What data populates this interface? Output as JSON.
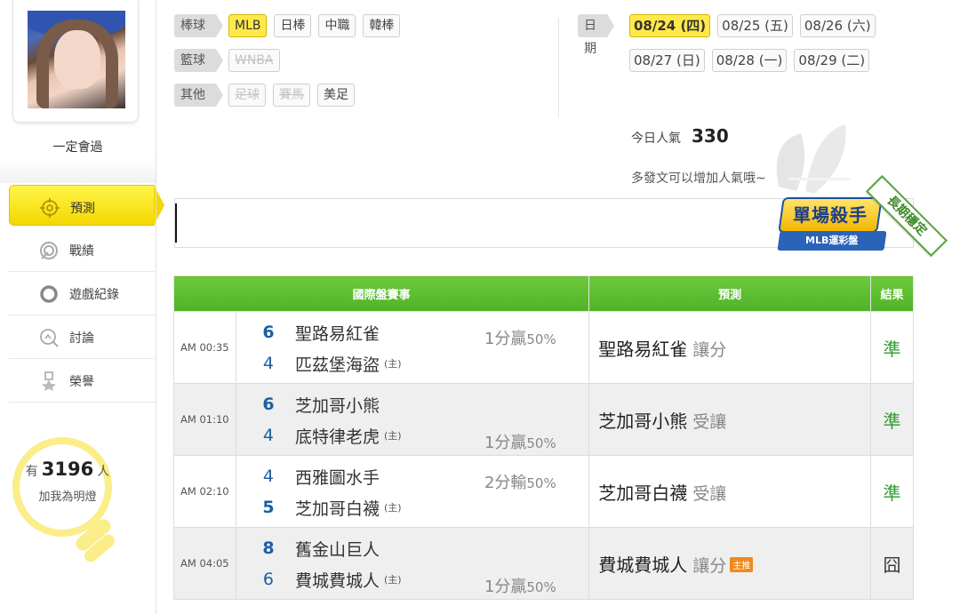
{
  "profile": {
    "username": "一定會過"
  },
  "menu": [
    {
      "label": "預測",
      "icon": "target-icon"
    },
    {
      "label": "戰績",
      "icon": "chart-icon"
    },
    {
      "label": "遊戲紀錄",
      "icon": "record-icon"
    },
    {
      "label": "討論",
      "icon": "chat-icon"
    },
    {
      "label": "榮譽",
      "icon": "medal-icon"
    }
  ],
  "fans": {
    "prefix": "有",
    "count": "3196",
    "suffix": "人",
    "caption": "加我為明燈"
  },
  "filters": {
    "baseball": {
      "label": "棒球",
      "items": [
        "MLB",
        "日棒",
        "中職",
        "韓棒"
      ]
    },
    "basketball": {
      "label": "籃球",
      "items": [
        "WNBA"
      ]
    },
    "other": {
      "label": "其他",
      "items": [
        "足球",
        "賽馬",
        "美足"
      ]
    }
  },
  "dates": {
    "label": "日期",
    "row1": [
      "08/24 (四)",
      "08/25 (五)",
      "08/26 (六)"
    ],
    "row2": [
      "08/27 (日)",
      "08/28 (一)",
      "08/29 (二)"
    ]
  },
  "popularity": {
    "label": "今日人氣",
    "value": "330",
    "hint": "多發文可以增加人氣哦~"
  },
  "badge": {
    "title": "單場殺手",
    "subtitle": "MLB運彩盤",
    "ribbon": "長期穩定"
  },
  "table": {
    "headers": {
      "match": "國際盤賽事",
      "prediction": "預測",
      "result": "結果"
    },
    "home_mark": "(主)",
    "rows": [
      {
        "time": "AM 00:35",
        "team1": {
          "score": "6",
          "name": "聖路易紅雀"
        },
        "team2": {
          "score": "4",
          "name": "匹茲堡海盜"
        },
        "line_text": "1分贏",
        "line_pct": "50%",
        "pick": "聖路易紅雀",
        "pick_type": "讓分",
        "pick_tag": "",
        "result": "準"
      },
      {
        "time": "AM 01:10",
        "team1": {
          "score": "6",
          "name": "芝加哥小熊"
        },
        "team2": {
          "score": "4",
          "name": "底特律老虎"
        },
        "line_text": "1分贏",
        "line_pct": "50%",
        "pick": "芝加哥小熊",
        "pick_type": "受讓",
        "pick_tag": "",
        "result": "準"
      },
      {
        "time": "AM 02:10",
        "team1": {
          "score": "4",
          "name": "西雅圖水手"
        },
        "team2": {
          "score": "5",
          "name": "芝加哥白襪"
        },
        "line_text": "2分輸",
        "line_pct": "50%",
        "pick": "芝加哥白襪",
        "pick_type": "受讓",
        "pick_tag": "",
        "result": "準"
      },
      {
        "time": "AM 04:05",
        "team1": {
          "score": "8",
          "name": "舊金山巨人"
        },
        "team2": {
          "score": "6",
          "name": "費城費城人"
        },
        "line_text": "1分贏",
        "line_pct": "50%",
        "pick": "費城費城人",
        "pick_type": "讓分",
        "pick_tag": "主推",
        "result": "囧"
      }
    ]
  }
}
